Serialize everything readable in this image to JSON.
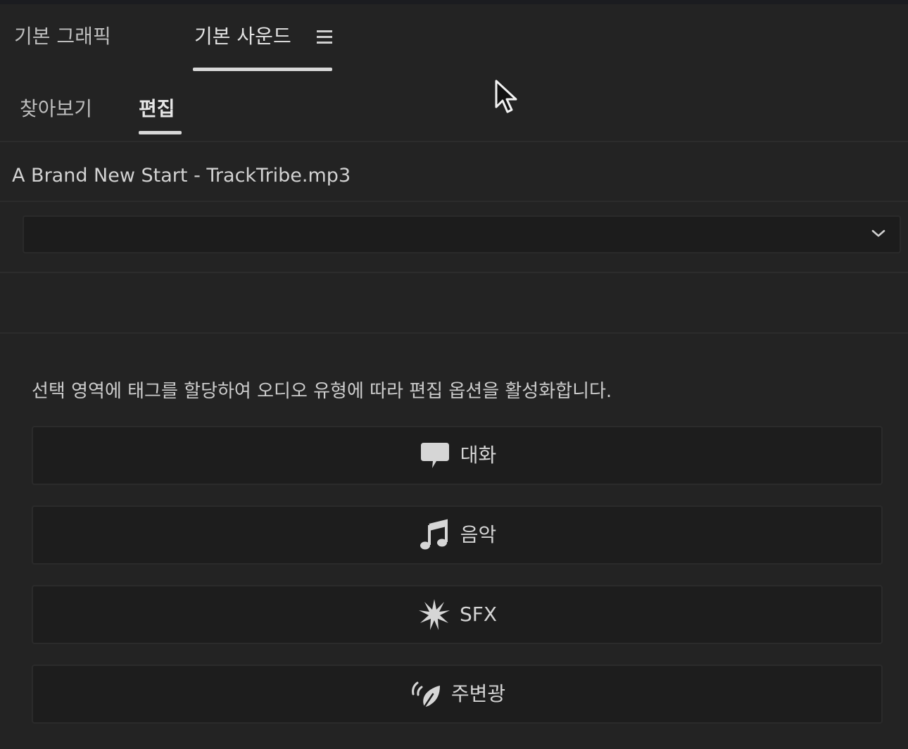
{
  "panel_tabs": [
    {
      "label": "기본 그래픽",
      "active": false
    },
    {
      "label": "기본 사운드",
      "active": true
    }
  ],
  "sub_tabs": [
    {
      "label": "찾아보기",
      "active": false
    },
    {
      "label": "편집",
      "active": true
    }
  ],
  "clip": {
    "name": "A Brand New Start - TrackTribe.mp3"
  },
  "preset_dropdown": {
    "value": ""
  },
  "description": "선택 영역에 태그를 할당하여 오디오 유형에 따라 편집 옵션을 활성화합니다.",
  "audio_types": [
    {
      "label": "대화",
      "icon": "speech-bubble-icon"
    },
    {
      "label": "음악",
      "icon": "music-note-icon"
    },
    {
      "label": "SFX",
      "icon": "burst-icon"
    },
    {
      "label": "주변광",
      "icon": "ambience-leaf-icon"
    }
  ],
  "colors": {
    "background": "#232323",
    "button_background": "#1d1d1d",
    "text": "#d4d4d4",
    "underline": "#d8d8d8"
  }
}
